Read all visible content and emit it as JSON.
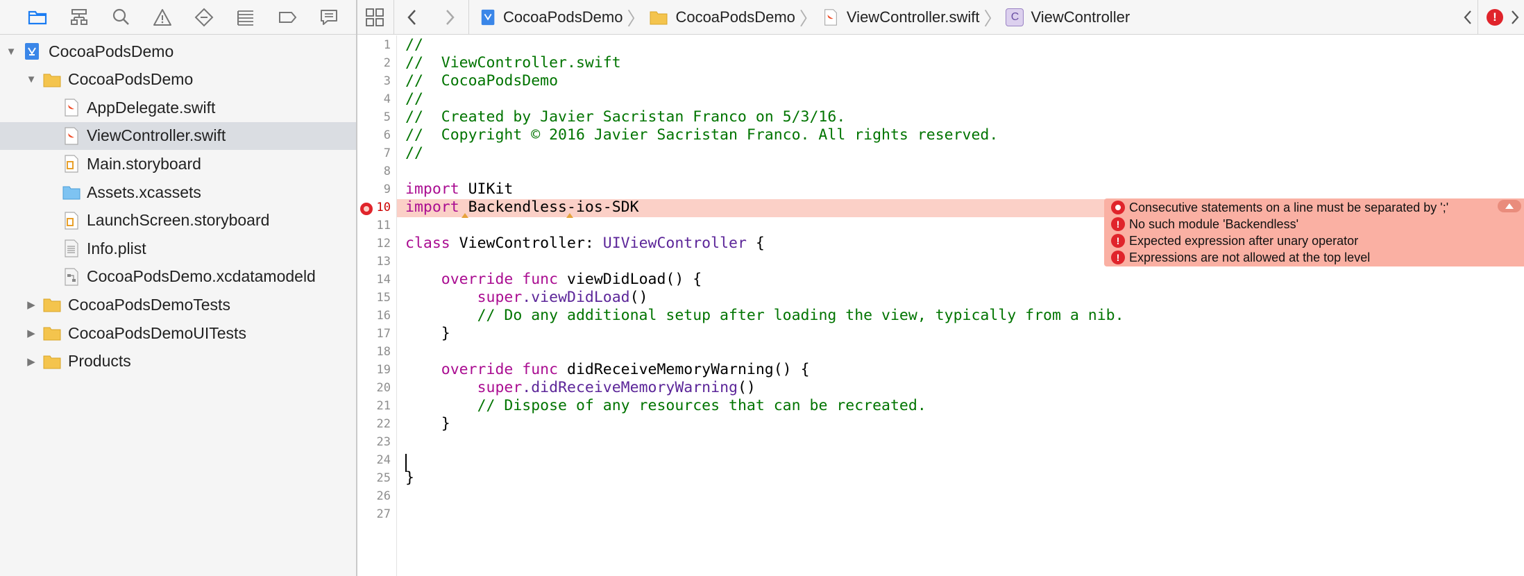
{
  "navigator": {
    "toolbar_icons": [
      "folder-icon",
      "hierarchy-icon",
      "search-icon",
      "warning-icon",
      "test-diamond-icon",
      "debug-icon",
      "breakpoint-icon",
      "report-icon"
    ],
    "items": [
      {
        "label": "CocoaPodsDemo",
        "icon": "project-icon",
        "expanded": true
      },
      {
        "label": "CocoaPodsDemo",
        "icon": "folder-icon",
        "expanded": true
      },
      {
        "label": "AppDelegate.swift",
        "icon": "swift-file-icon"
      },
      {
        "label": "ViewController.swift",
        "icon": "swift-file-icon",
        "selected": true
      },
      {
        "label": "Main.storyboard",
        "icon": "storyboard-icon"
      },
      {
        "label": "Assets.xcassets",
        "icon": "assets-folder-icon"
      },
      {
        "label": "LaunchScreen.storyboard",
        "icon": "storyboard-icon"
      },
      {
        "label": "Info.plist",
        "icon": "plist-icon"
      },
      {
        "label": "CocoaPodsDemo.xcdatamodeld",
        "icon": "datamodel-icon"
      },
      {
        "label": "CocoaPodsDemoTests",
        "icon": "folder-icon",
        "expanded": false
      },
      {
        "label": "CocoaPodsDemoUITests",
        "icon": "folder-icon",
        "expanded": false
      },
      {
        "label": "Products",
        "icon": "folder-icon",
        "expanded": false
      }
    ]
  },
  "jumpbar": {
    "breadcrumbs": [
      "CocoaPodsDemo",
      "CocoaPodsDemo",
      "ViewController.swift",
      "ViewController"
    ]
  },
  "editor": {
    "line_numbers": [
      "1",
      "2",
      "3",
      "4",
      "5",
      "6",
      "7",
      "8",
      "9",
      "10",
      "11",
      "12",
      "13",
      "14",
      "15",
      "16",
      "17",
      "18",
      "19",
      "20",
      "21",
      "22",
      "23",
      "24",
      "25",
      "26",
      "27"
    ],
    "lines": {
      "l1": "//",
      "l2": "//  ViewController.swift",
      "l3": "//  CocoaPodsDemo",
      "l4": "//",
      "l5": "//  Created by Javier Sacristan Franco on 5/3/16.",
      "l6": "//  Copyright © 2016 Javier Sacristan Franco. All rights reserved.",
      "l7": "//",
      "kw_import": "import",
      "l9_rest": " UIKit",
      "l10_rest": " Backendless-ios-SDK",
      "kw_class": "class",
      "l12_name": " ViewController: ",
      "l12_type": "UIViewController",
      "l12_end": " {",
      "kw_override": "override",
      "kw_func": "func",
      "l14_rest": " viewDidLoad() {",
      "kw_super": "super",
      "l15_fn": ".viewDidLoad",
      "l15_end": "()",
      "l16": "// Do any additional setup after loading the view, typically from a nib.",
      "close_brace": "}",
      "l19_rest": " didReceiveMemoryWarning() {",
      "l20_fn": ".didReceiveMemoryWarning",
      "l20_end": "()",
      "l21": "// Dispose of any resources that can be recreated."
    },
    "errors": [
      "Consecutive statements on a line must be separated by ';'",
      "No such module 'Backendless'",
      "Expected expression after unary operator",
      "Expressions are not allowed at the top level"
    ]
  },
  "colors": {
    "keyword": "#aa0d91",
    "comment": "#007400",
    "type": "#5c2699",
    "error": "#e0242b",
    "error_line": "#fbd0c7",
    "error_panel": "#fab0a3"
  }
}
